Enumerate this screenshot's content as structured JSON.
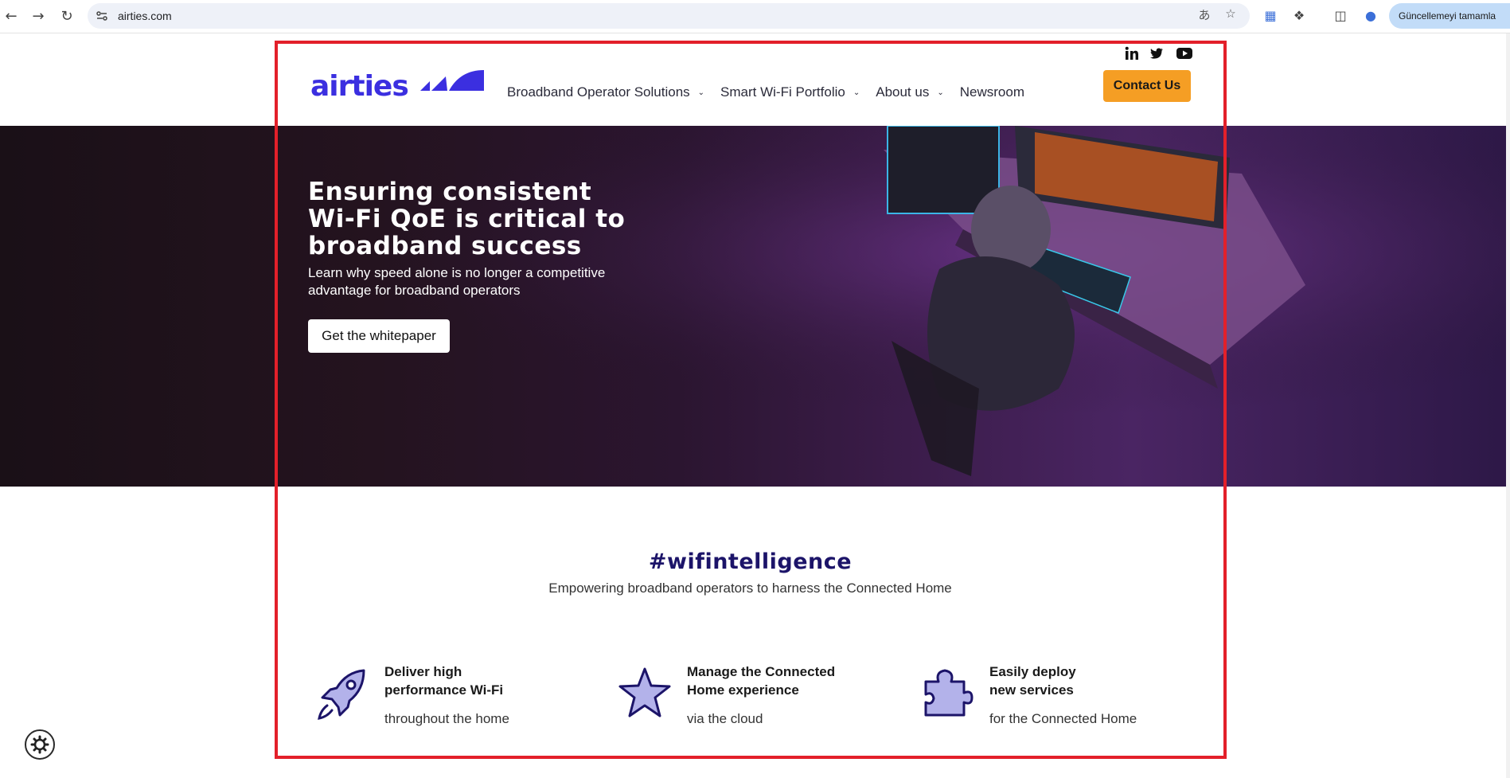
{
  "browser": {
    "url": "airties.com",
    "update_label": "Güncellemeyi tamamla"
  },
  "header": {
    "logo_text": "airties",
    "menu": [
      {
        "label": "Broadband Operator Solutions",
        "has_dropdown": true
      },
      {
        "label": "Smart Wi-Fi Portfolio",
        "has_dropdown": true
      },
      {
        "label": "About us",
        "has_dropdown": true
      },
      {
        "label": "Newsroom",
        "has_dropdown": false
      }
    ],
    "social": [
      "linkedin-icon",
      "twitter-icon",
      "youtube-icon"
    ],
    "contact_label": "Contact Us"
  },
  "hero": {
    "title_line1": "Ensuring consistent",
    "title_line2": "Wi-Fi QoE is critical to",
    "title_line3": "broadband success",
    "subtitle": "Learn why speed alone is no longer a competitive advantage for broadband operators",
    "cta_label": "Get the whitepaper"
  },
  "section": {
    "title": "#wifintelligence",
    "subtitle": "Empowering broadband operators to harness the Connected Home"
  },
  "features": [
    {
      "icon": "rocket-icon",
      "title": "Deliver high\nperformance Wi-Fi",
      "desc": "throughout the home"
    },
    {
      "icon": "star-icon",
      "title": "Manage the Connected\nHome experience",
      "desc": "via the cloud"
    },
    {
      "icon": "puzzle-icon",
      "title": "Easily deploy\nnew services",
      "desc": "for the Connected Home"
    }
  ],
  "colors": {
    "brand": "#3b2fe0",
    "accent": "#f59e24",
    "heading": "#1c1469",
    "frame": "#e3202a"
  }
}
